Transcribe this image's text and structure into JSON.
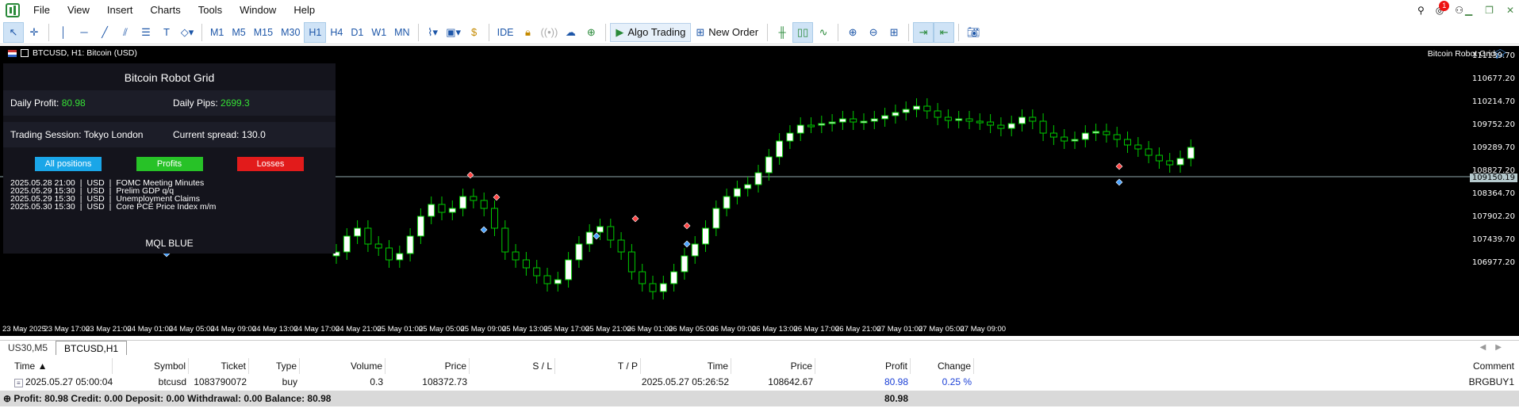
{
  "menu": [
    "File",
    "View",
    "Insert",
    "Charts",
    "Tools",
    "Window",
    "Help"
  ],
  "toolbar": {
    "timeframes": [
      "M1",
      "M5",
      "M15",
      "M30",
      "H1",
      "H4",
      "D1",
      "W1",
      "MN"
    ],
    "active_timeframe": "H1",
    "ide_label": "IDE",
    "algo_label": "Algo Trading",
    "new_order_label": "New Order"
  },
  "notifications_count": "1",
  "chart": {
    "title": "BTCUSD, H1:  Bitcoin (USD)",
    "ea_name": "Bitcoin Robot Grid",
    "price_labels": [
      "111139.70",
      "110677.20",
      "110214.70",
      "109752.20",
      "109289.70",
      "108827.20",
      "108364.70",
      "107902.20",
      "107439.70",
      "106977.20"
    ],
    "current_price": "109150.19",
    "time_labels": [
      "23 May 2025",
      "23 May 17:00",
      "23 May 21:00",
      "24 May 01:00",
      "24 May 05:00",
      "24 May 09:00",
      "24 May 13:00",
      "24 May 17:00",
      "24 May 21:00",
      "25 May 01:00",
      "25 May 05:00",
      "25 May 09:00",
      "25 May 13:00",
      "25 May 17:00",
      "25 May 21:00",
      "26 May 01:00",
      "26 May 05:00",
      "26 May 09:00",
      "26 May 13:00",
      "26 May 17:00",
      "26 May 21:00",
      "27 May 01:00",
      "27 May 05:00",
      "27 May 09:00"
    ]
  },
  "robot": {
    "title": "Bitcoin Robot Grid",
    "daily_profit_label": "Daily Profit:",
    "daily_profit": "80.98",
    "daily_pips_label": "Daily Pips:",
    "daily_pips": "2699.3",
    "session_label": "Trading Session: Tokyo London",
    "spread_label": "Current spread: 130.0",
    "buttons": {
      "all": "All positions",
      "profits": "Profits",
      "losses": "Losses"
    },
    "news": [
      {
        "time": "2025.05.28 21:00",
        "currency": "USD",
        "event": "FOMC Meeting Minutes"
      },
      {
        "time": "2025.05.29 15:30",
        "currency": "USD",
        "event": "Prelim GDP q/q"
      },
      {
        "time": "2025.05.29 15:30",
        "currency": "USD",
        "event": "Unemployment Claims"
      },
      {
        "time": "2025.05.30 15:30",
        "currency": "USD",
        "event": "Core PCE Price Index m/m"
      }
    ],
    "footer": "MQL BLUE"
  },
  "tabs": [
    "US30,M5",
    "BTCUSD,H1"
  ],
  "active_tab": "BTCUSD,H1",
  "table": {
    "headers": [
      "Time",
      "Symbol",
      "Ticket",
      "Type",
      "Volume",
      "Price",
      "S / L",
      "T / P",
      "Time",
      "Price",
      "Profit",
      "Change",
      "Comment"
    ],
    "rows": [
      [
        "2025.05.27 05:00:04",
        "btcusd",
        "1083790072",
        "buy",
        "0.3",
        "108372.73",
        "",
        "",
        "2025.05.27 05:26:52",
        "108642.67",
        "80.98",
        "0.25 %",
        "BRGBUY1"
      ]
    ],
    "summary": "Profit: 80.98  Credit: 0.00  Deposit: 0.00  Withdrawal: 0.00  Balance: 80.98",
    "summary_profit": "80.98"
  },
  "colors": {
    "bull": "#ffffff",
    "bear": "#000000",
    "wick": "#00cc00",
    "chart_bg": "#000000",
    "grid_price_line": "#8fa8ad"
  }
}
